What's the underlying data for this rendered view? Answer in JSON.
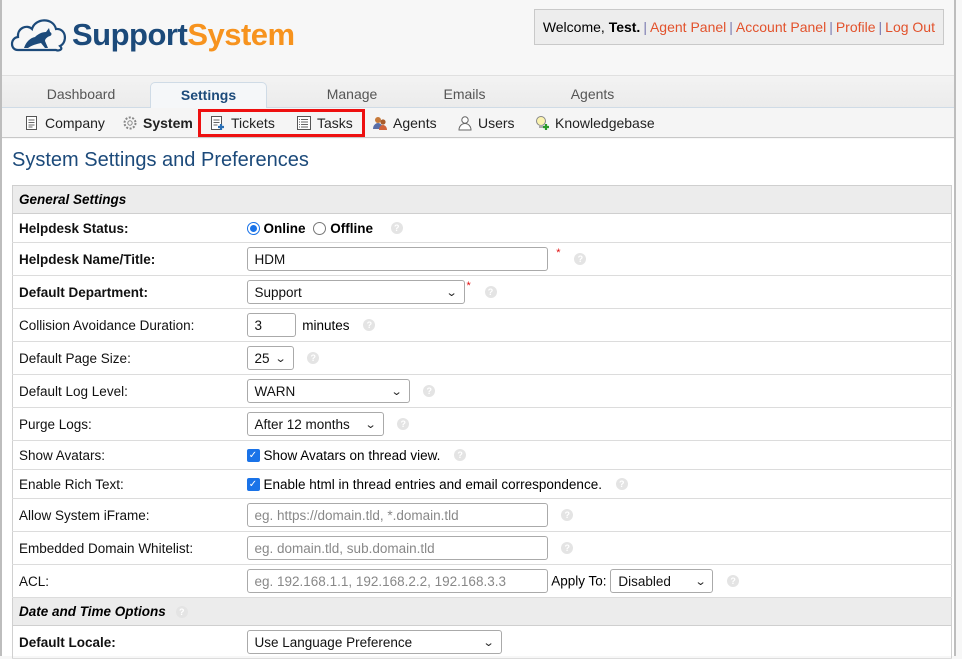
{
  "brand": {
    "name_part1": "Support",
    "name_part2": "System",
    "colors": {
      "primary": "#1c4a7a",
      "accent": "#f7931e",
      "link": "#e2522c",
      "highlight": "#ee1010"
    }
  },
  "userbox": {
    "welcome_prefix": "Welcome, ",
    "user_name": "Test.",
    "links": [
      "Agent Panel",
      "Account Panel",
      "Profile",
      "Log Out"
    ]
  },
  "tabs": [
    {
      "label": "Dashboard",
      "active": false
    },
    {
      "label": "Settings",
      "active": true
    },
    {
      "label": "Manage",
      "active": false
    },
    {
      "label": "Emails",
      "active": false
    },
    {
      "label": "Agents",
      "active": false
    }
  ],
  "subnav": [
    {
      "label": "Company",
      "icon": "document-icon",
      "active": false
    },
    {
      "label": "System",
      "icon": "gear-icon",
      "active": true
    },
    {
      "label": "Tickets",
      "icon": "ticket-add-icon",
      "active": false
    },
    {
      "label": "Tasks",
      "icon": "task-list-icon",
      "active": false
    },
    {
      "label": "Agents",
      "icon": "agents-icon",
      "active": false
    },
    {
      "label": "Users",
      "icon": "user-icon",
      "active": false
    },
    {
      "label": "Knowledgebase",
      "icon": "lightbulb-add-icon",
      "active": false
    }
  ],
  "page_title": "System Settings and Preferences",
  "sections": {
    "general": "General Settings",
    "datetime": "Date and Time Options"
  },
  "fields": {
    "helpdesk_status": {
      "label": "Helpdesk Status:",
      "options": [
        "Online",
        "Offline"
      ],
      "selected": "Online"
    },
    "helpdesk_name": {
      "label": "Helpdesk Name/Title:",
      "value": "HDM"
    },
    "default_department": {
      "label": "Default Department:",
      "value": "Support"
    },
    "collision": {
      "label": "Collision Avoidance Duration:",
      "value": "3",
      "unit": "minutes"
    },
    "page_size": {
      "label": "Default Page Size:",
      "value": "25"
    },
    "log_level": {
      "label": "Default Log Level:",
      "value": "WARN"
    },
    "purge_logs": {
      "label": "Purge Logs:",
      "value": "After 12 months"
    },
    "show_avatars": {
      "label": "Show Avatars:",
      "checkbox_label": "Show Avatars on thread view.",
      "checked": true
    },
    "rich_text": {
      "label": "Enable Rich Text:",
      "checkbox_label": "Enable html in thread entries and email correspondence.",
      "checked": true
    },
    "iframe": {
      "label": "Allow System iFrame:",
      "placeholder": "eg. https://domain.tld, *.domain.tld",
      "value": ""
    },
    "whitelist": {
      "label": "Embedded Domain Whitelist:",
      "placeholder": "eg. domain.tld, sub.domain.tld",
      "value": ""
    },
    "acl": {
      "label": "ACL:",
      "placeholder": "eg. 192.168.1.1, 192.168.2.2, 192.168.3.3",
      "value": "",
      "apply_to_label": "Apply To:",
      "apply_to_value": "Disabled"
    },
    "default_locale": {
      "label": "Default Locale:",
      "value": "Use Language Preference"
    }
  },
  "required_marker": "*",
  "help_glyph": "?"
}
